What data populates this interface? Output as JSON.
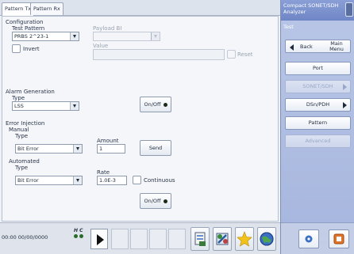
{
  "tabs": [
    "Pattern Tx",
    "Pattern Rx"
  ],
  "configuration": {
    "group_title": "Configuration",
    "test_pattern_label": "Test Pattern",
    "test_pattern_value": "PRBS 2^23-1",
    "payload_label": "Payload BI",
    "payload_value": "",
    "invert_label": "Invert",
    "value_label": "Value",
    "value_value": "",
    "reset_label": "Reset"
  },
  "alarm": {
    "group_title": "Alarm Generation",
    "type_label": "Type",
    "type_value": "LSS",
    "onoff_label": "On/Off"
  },
  "error": {
    "group_title": "Error Injection",
    "manual_label": "Manual",
    "type_label": "Type",
    "amount_label": "Amount",
    "manual_type_value": "Bit Error",
    "amount_value": "1",
    "send_label": "Send",
    "automated_label": "Automated",
    "auto_type_label": "Type",
    "rate_label": "Rate",
    "auto_type_value": "Bit Error",
    "rate_value": "1.0E-3",
    "continuous_label": "Continuous",
    "onoff_label": "On/Off"
  },
  "status": {
    "clock": "00:00 00/00/0000",
    "hc_label": "H C"
  },
  "side": {
    "header": "Compact SONET/SDH Analyzer",
    "tab_label": "Test",
    "back_label": "Back",
    "main_menu_label": "Main Menu",
    "items": [
      "Port",
      "SONET/SDH",
      "DSn/PDH",
      "Pattern",
      "Advanced"
    ]
  },
  "colors": {
    "accent_blue": "#6f86c6",
    "sidebar": "#b0bee2",
    "panel": "#f4f6fa"
  }
}
